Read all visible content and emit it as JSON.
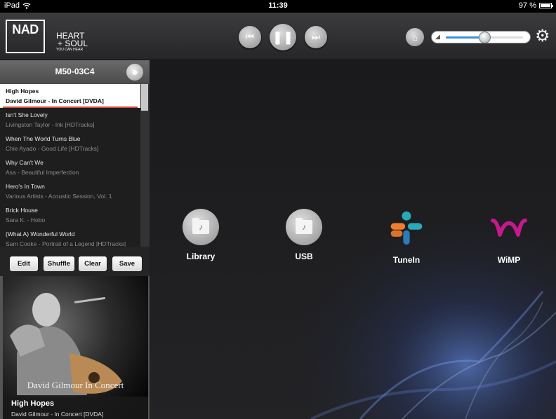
{
  "status": {
    "device": "iPad",
    "time": "11:39",
    "battery": "97 %",
    "battery_level": 0.97
  },
  "header": {
    "logo": "NAD",
    "tagline": [
      "HEART",
      "+ SOUL",
      "YOU CAN HEAR"
    ],
    "volume_level": 0.5
  },
  "sidebar": {
    "title": "M50-03C4",
    "queue": [
      {
        "title": "High Hopes",
        "subtitle": "David Gilmour - In Concert [DVDA]",
        "active": true
      },
      {
        "title": "Isn't She Lovely",
        "subtitle": "Livingston Taylor - Ink [HDTracks]"
      },
      {
        "title": "When The World Turns Blue",
        "subtitle": "Chie Ayado - Good Life [HDTracks]"
      },
      {
        "title": "Why Can't We",
        "subtitle": "Asa - Beautiful Imperfection"
      },
      {
        "title": "Hero's In Town",
        "subtitle": "Various Artists - Acoustic Session, Vol. 1"
      },
      {
        "title": "Brick House",
        "subtitle": "Sara K. - Hobo"
      },
      {
        "title": "(What A) Wonderful World",
        "subtitle": "Sam Cooke - Portrait of a Legend [HDTracks]"
      }
    ],
    "actions": {
      "edit": "Edit",
      "shuffle": "Shuffle",
      "clear": "Clear",
      "save": "Save"
    },
    "cover_text": "David Gilmour In Concert",
    "now_playing": {
      "title": "High Hopes",
      "subtitle": "David Gilmour - In Concert [DVDA]"
    }
  },
  "sources": [
    {
      "label": "Library",
      "icon": "library-folder-icon"
    },
    {
      "label": "USB",
      "icon": "usb-folder-icon"
    },
    {
      "label": "TuneIn",
      "icon": "tunein-icon"
    },
    {
      "label": "WiMP",
      "icon": "wimp-icon"
    }
  ],
  "colors": {
    "accent": "#d7463c",
    "volume": "#3a8fe0",
    "wimp": "#c6198c"
  }
}
